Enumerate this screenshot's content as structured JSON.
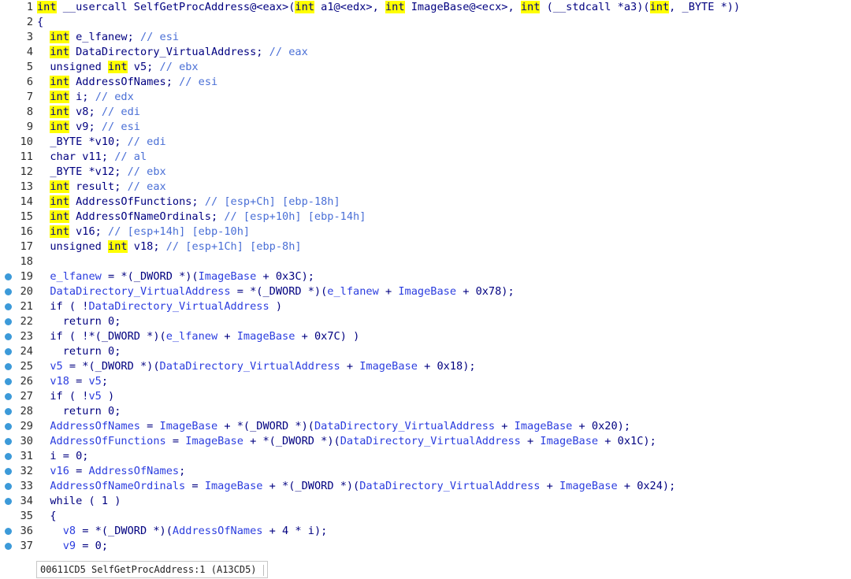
{
  "code_lines": [
    {
      "n": "1",
      "bp": false,
      "tokens": [
        {
          "t": "int",
          "c": "hl"
        },
        {
          "t": " __usercall SelfGetProcAddress@<eax>(",
          "c": "kw"
        },
        {
          "t": "int",
          "c": "hl"
        },
        {
          "t": " a1@<edx>, ",
          "c": "kw"
        },
        {
          "t": "int",
          "c": "hl"
        },
        {
          "t": " ImageBase@<ecx>, ",
          "c": "kw"
        },
        {
          "t": "int",
          "c": "hl"
        },
        {
          "t": " (__stdcall *a3)(",
          "c": "kw"
        },
        {
          "t": "int",
          "c": "hl"
        },
        {
          "t": ", _BYTE *))",
          "c": "kw"
        }
      ]
    },
    {
      "n": "2",
      "bp": false,
      "tokens": [
        {
          "t": "{",
          "c": "kw"
        }
      ]
    },
    {
      "n": "3",
      "bp": false,
      "tokens": [
        {
          "t": "  ",
          "c": "kw"
        },
        {
          "t": "int",
          "c": "hl"
        },
        {
          "t": " e_lfanew; ",
          "c": "kw"
        },
        {
          "t": "// esi",
          "c": "cm"
        }
      ]
    },
    {
      "n": "4",
      "bp": false,
      "tokens": [
        {
          "t": "  ",
          "c": "kw"
        },
        {
          "t": "int",
          "c": "hl"
        },
        {
          "t": " DataDirectory_VirtualAddress; ",
          "c": "kw"
        },
        {
          "t": "// eax",
          "c": "cm"
        }
      ]
    },
    {
      "n": "5",
      "bp": false,
      "tokens": [
        {
          "t": "  unsigned ",
          "c": "kw"
        },
        {
          "t": "int",
          "c": "hl"
        },
        {
          "t": " v5; ",
          "c": "kw"
        },
        {
          "t": "// ebx",
          "c": "cm"
        }
      ]
    },
    {
      "n": "6",
      "bp": false,
      "tokens": [
        {
          "t": "  ",
          "c": "kw"
        },
        {
          "t": "int",
          "c": "hl"
        },
        {
          "t": " AddressOfNames; ",
          "c": "kw"
        },
        {
          "t": "// esi",
          "c": "cm"
        }
      ]
    },
    {
      "n": "7",
      "bp": false,
      "tokens": [
        {
          "t": "  ",
          "c": "kw"
        },
        {
          "t": "int",
          "c": "hl"
        },
        {
          "t": " i; ",
          "c": "kw"
        },
        {
          "t": "// edx",
          "c": "cm"
        }
      ]
    },
    {
      "n": "8",
      "bp": false,
      "tokens": [
        {
          "t": "  ",
          "c": "kw"
        },
        {
          "t": "int",
          "c": "hl"
        },
        {
          "t": " v8; ",
          "c": "kw"
        },
        {
          "t": "// edi",
          "c": "cm"
        }
      ]
    },
    {
      "n": "9",
      "bp": false,
      "tokens": [
        {
          "t": "  ",
          "c": "kw"
        },
        {
          "t": "int",
          "c": "hl"
        },
        {
          "t": " v9; ",
          "c": "kw"
        },
        {
          "t": "// esi",
          "c": "cm"
        }
      ]
    },
    {
      "n": "10",
      "bp": false,
      "tokens": [
        {
          "t": "  _BYTE *v10; ",
          "c": "kw"
        },
        {
          "t": "// edi",
          "c": "cm"
        }
      ]
    },
    {
      "n": "11",
      "bp": false,
      "tokens": [
        {
          "t": "  char v11; ",
          "c": "kw"
        },
        {
          "t": "// al",
          "c": "cm"
        }
      ]
    },
    {
      "n": "12",
      "bp": false,
      "tokens": [
        {
          "t": "  _BYTE *v12; ",
          "c": "kw"
        },
        {
          "t": "// ebx",
          "c": "cm"
        }
      ]
    },
    {
      "n": "13",
      "bp": false,
      "tokens": [
        {
          "t": "  ",
          "c": "kw"
        },
        {
          "t": "int",
          "c": "hl"
        },
        {
          "t": " result; ",
          "c": "kw"
        },
        {
          "t": "// eax",
          "c": "cm"
        }
      ]
    },
    {
      "n": "14",
      "bp": false,
      "tokens": [
        {
          "t": "  ",
          "c": "kw"
        },
        {
          "t": "int",
          "c": "hl"
        },
        {
          "t": " AddressOfFunctions; ",
          "c": "kw"
        },
        {
          "t": "// [esp+Ch] [ebp-18h]",
          "c": "cm"
        }
      ]
    },
    {
      "n": "15",
      "bp": false,
      "tokens": [
        {
          "t": "  ",
          "c": "kw"
        },
        {
          "t": "int",
          "c": "hl"
        },
        {
          "t": " AddressOfNameOrdinals; ",
          "c": "kw"
        },
        {
          "t": "// [esp+10h] [ebp-14h]",
          "c": "cm"
        }
      ]
    },
    {
      "n": "16",
      "bp": false,
      "tokens": [
        {
          "t": "  ",
          "c": "kw"
        },
        {
          "t": "int",
          "c": "hl"
        },
        {
          "t": " v16; ",
          "c": "kw"
        },
        {
          "t": "// [esp+14h] [ebp-10h]",
          "c": "cm"
        }
      ]
    },
    {
      "n": "17",
      "bp": false,
      "tokens": [
        {
          "t": "  unsigned ",
          "c": "kw"
        },
        {
          "t": "int",
          "c": "hl"
        },
        {
          "t": " v18; ",
          "c": "kw"
        },
        {
          "t": "// [esp+1Ch] [ebp-8h]",
          "c": "cm"
        }
      ]
    },
    {
      "n": "18",
      "bp": false,
      "tokens": []
    },
    {
      "n": "19",
      "bp": true,
      "tokens": [
        {
          "t": "  ",
          "c": "kw"
        },
        {
          "t": "e_lfanew",
          "c": "v"
        },
        {
          "t": " = *(_DWORD *)(",
          "c": "kw"
        },
        {
          "t": "ImageBase",
          "c": "v"
        },
        {
          "t": " + 0x3C);",
          "c": "kw"
        }
      ]
    },
    {
      "n": "20",
      "bp": true,
      "tokens": [
        {
          "t": "  ",
          "c": "kw"
        },
        {
          "t": "DataDirectory_VirtualAddress",
          "c": "v"
        },
        {
          "t": " = *(_DWORD *)(",
          "c": "kw"
        },
        {
          "t": "e_lfanew",
          "c": "v"
        },
        {
          "t": " + ",
          "c": "kw"
        },
        {
          "t": "ImageBase",
          "c": "v"
        },
        {
          "t": " + 0x78);",
          "c": "kw"
        }
      ]
    },
    {
      "n": "21",
      "bp": true,
      "tokens": [
        {
          "t": "  if ( !",
          "c": "kw"
        },
        {
          "t": "DataDirectory_VirtualAddress",
          "c": "v"
        },
        {
          "t": " )",
          "c": "kw"
        }
      ]
    },
    {
      "n": "22",
      "bp": true,
      "tokens": [
        {
          "t": "    return 0;",
          "c": "kw"
        }
      ]
    },
    {
      "n": "23",
      "bp": true,
      "tokens": [
        {
          "t": "  if ( !*(_DWORD *)(",
          "c": "kw"
        },
        {
          "t": "e_lfanew",
          "c": "v"
        },
        {
          "t": " + ",
          "c": "kw"
        },
        {
          "t": "ImageBase",
          "c": "v"
        },
        {
          "t": " + 0x7C) )",
          "c": "kw"
        }
      ]
    },
    {
      "n": "24",
      "bp": true,
      "tokens": [
        {
          "t": "    return 0;",
          "c": "kw"
        }
      ]
    },
    {
      "n": "25",
      "bp": true,
      "tokens": [
        {
          "t": "  ",
          "c": "kw"
        },
        {
          "t": "v5",
          "c": "v"
        },
        {
          "t": " = *(_DWORD *)(",
          "c": "kw"
        },
        {
          "t": "DataDirectory_VirtualAddress",
          "c": "v"
        },
        {
          "t": " + ",
          "c": "kw"
        },
        {
          "t": "ImageBase",
          "c": "v"
        },
        {
          "t": " + 0x18);",
          "c": "kw"
        }
      ]
    },
    {
      "n": "26",
      "bp": true,
      "tokens": [
        {
          "t": "  ",
          "c": "kw"
        },
        {
          "t": "v18",
          "c": "v"
        },
        {
          "t": " = ",
          "c": "kw"
        },
        {
          "t": "v5",
          "c": "v"
        },
        {
          "t": ";",
          "c": "kw"
        }
      ]
    },
    {
      "n": "27",
      "bp": true,
      "tokens": [
        {
          "t": "  if ( !",
          "c": "kw"
        },
        {
          "t": "v5",
          "c": "v"
        },
        {
          "t": " )",
          "c": "kw"
        }
      ]
    },
    {
      "n": "28",
      "bp": true,
      "tokens": [
        {
          "t": "    return 0;",
          "c": "kw"
        }
      ]
    },
    {
      "n": "29",
      "bp": true,
      "tokens": [
        {
          "t": "  ",
          "c": "kw"
        },
        {
          "t": "AddressOfNames",
          "c": "v"
        },
        {
          "t": " = ",
          "c": "kw"
        },
        {
          "t": "ImageBase",
          "c": "v"
        },
        {
          "t": " + *(_DWORD *)(",
          "c": "kw"
        },
        {
          "t": "DataDirectory_VirtualAddress",
          "c": "v"
        },
        {
          "t": " + ",
          "c": "kw"
        },
        {
          "t": "ImageBase",
          "c": "v"
        },
        {
          "t": " + 0x20);",
          "c": "kw"
        }
      ]
    },
    {
      "n": "30",
      "bp": true,
      "tokens": [
        {
          "t": "  ",
          "c": "kw"
        },
        {
          "t": "AddressOfFunctions",
          "c": "v"
        },
        {
          "t": " = ",
          "c": "kw"
        },
        {
          "t": "ImageBase",
          "c": "v"
        },
        {
          "t": " + *(_DWORD *)(",
          "c": "kw"
        },
        {
          "t": "DataDirectory_VirtualAddress",
          "c": "v"
        },
        {
          "t": " + ",
          "c": "kw"
        },
        {
          "t": "ImageBase",
          "c": "v"
        },
        {
          "t": " + 0x1C);",
          "c": "kw"
        }
      ]
    },
    {
      "n": "31",
      "bp": true,
      "tokens": [
        {
          "t": "  i = 0;",
          "c": "kw"
        }
      ]
    },
    {
      "n": "32",
      "bp": true,
      "tokens": [
        {
          "t": "  ",
          "c": "kw"
        },
        {
          "t": "v16",
          "c": "v"
        },
        {
          "t": " = ",
          "c": "kw"
        },
        {
          "t": "AddressOfNames",
          "c": "v"
        },
        {
          "t": ";",
          "c": "kw"
        }
      ]
    },
    {
      "n": "33",
      "bp": true,
      "tokens": [
        {
          "t": "  ",
          "c": "kw"
        },
        {
          "t": "AddressOfNameOrdinals",
          "c": "v"
        },
        {
          "t": " = ",
          "c": "kw"
        },
        {
          "t": "ImageBase",
          "c": "v"
        },
        {
          "t": " + *(_DWORD *)(",
          "c": "kw"
        },
        {
          "t": "DataDirectory_VirtualAddress",
          "c": "v"
        },
        {
          "t": " + ",
          "c": "kw"
        },
        {
          "t": "ImageBase",
          "c": "v"
        },
        {
          "t": " + 0x24);",
          "c": "kw"
        }
      ]
    },
    {
      "n": "34",
      "bp": true,
      "tokens": [
        {
          "t": "  while ( 1 )",
          "c": "kw"
        }
      ]
    },
    {
      "n": "35",
      "bp": false,
      "tokens": [
        {
          "t": "  {",
          "c": "kw"
        }
      ]
    },
    {
      "n": "36",
      "bp": true,
      "tokens": [
        {
          "t": "    ",
          "c": "kw"
        },
        {
          "t": "v8",
          "c": "v"
        },
        {
          "t": " = *(_DWORD *)(",
          "c": "kw"
        },
        {
          "t": "AddressOfNames",
          "c": "v"
        },
        {
          "t": " + 4 * i);",
          "c": "kw"
        }
      ]
    },
    {
      "n": "37",
      "bp": true,
      "tokens": [
        {
          "t": "    ",
          "c": "kw"
        },
        {
          "t": "v9",
          "c": "v"
        },
        {
          "t": " = 0;",
          "c": "kw"
        }
      ]
    }
  ],
  "status_bar": {
    "location": "00611CD5 SelfGetProcAddress:1 (A13CD5)"
  },
  "colors": {
    "keyword_highlight": "#ffff00",
    "text": "#000080",
    "comment": "#4a6fd6",
    "variable": "#2b3ddf",
    "breakpoint_dot": "#3c9ad9"
  }
}
